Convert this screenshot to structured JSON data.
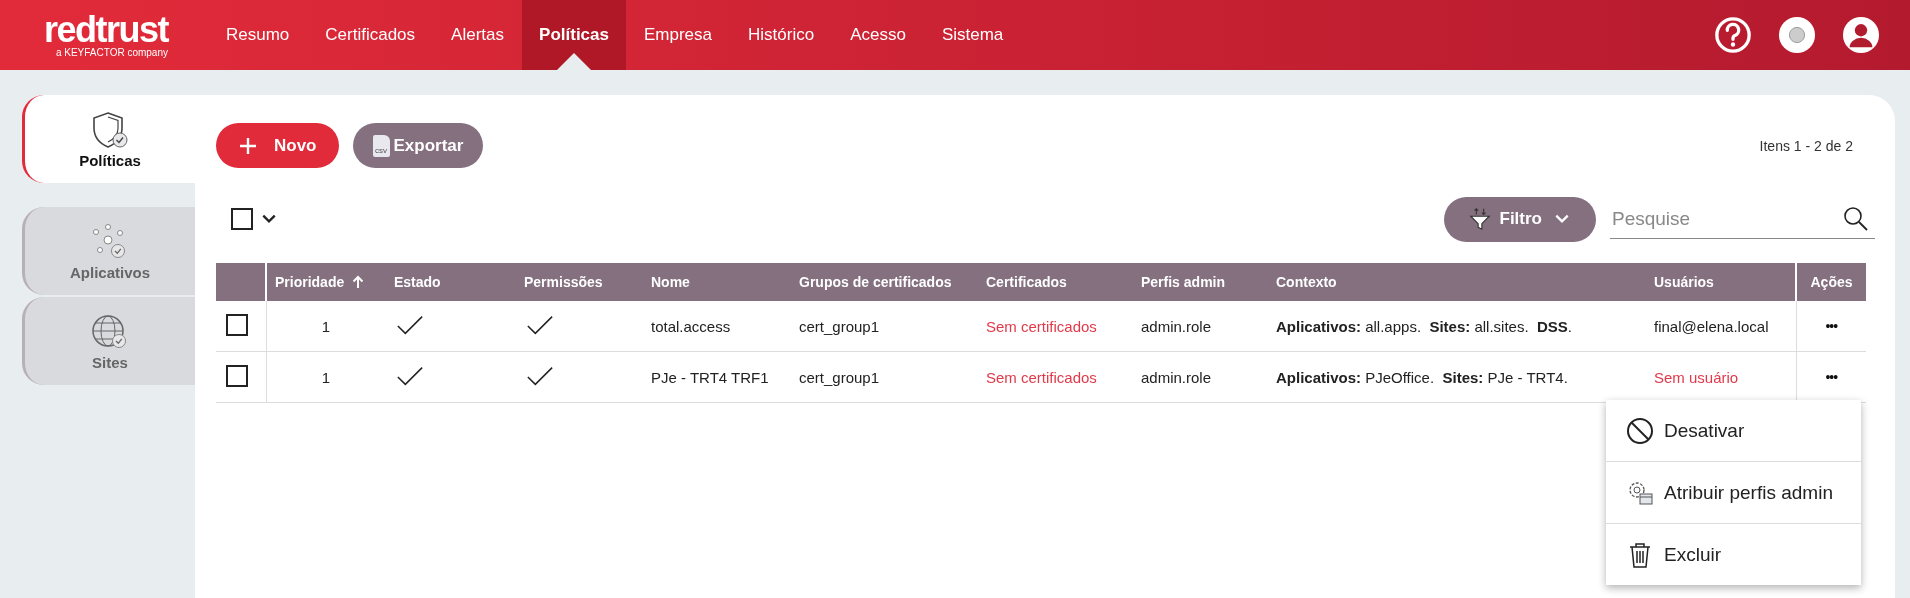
{
  "brand": {
    "name": "redtrust",
    "tagline": "a KEYFACTOR company"
  },
  "nav": [
    {
      "label": "Resumo",
      "selected": false
    },
    {
      "label": "Certificados",
      "selected": false
    },
    {
      "label": "Alertas",
      "selected": false
    },
    {
      "label": "Políticas",
      "selected": true
    },
    {
      "label": "Empresa",
      "selected": false
    },
    {
      "label": "Histórico",
      "selected": false
    },
    {
      "label": "Acesso",
      "selected": false
    },
    {
      "label": "Sistema",
      "selected": false
    }
  ],
  "sidebar": [
    {
      "label": "Políticas",
      "kind": "shield",
      "selected": true
    },
    {
      "label": "Aplicativos",
      "kind": "apps",
      "selected": false
    },
    {
      "label": "Sites",
      "kind": "globe",
      "selected": false
    }
  ],
  "toolbar": {
    "new_button": "Novo",
    "export_button": "Exportar",
    "export_icon_label": "csv",
    "count": "Itens 1 - 2 de 2",
    "filter_button": "Filtro",
    "search": {
      "placeholder": "Pesquise"
    },
    "select_all": {
      "checked": false
    }
  },
  "table": {
    "columns": [
      {
        "label": "Prioridade",
        "sorted_ascending": true
      },
      {
        "label": "Estado"
      },
      {
        "label": "Permissões"
      },
      {
        "label": "Nome"
      },
      {
        "label": "Grupos de certificados"
      },
      {
        "label": "Certificados"
      },
      {
        "label": "Perfis admin"
      },
      {
        "label": "Contexto"
      },
      {
        "label": "Usuários"
      },
      {
        "label": "Ações"
      }
    ],
    "rows": [
      {
        "checked": false,
        "priority": "1",
        "enabled": true,
        "permissions": true,
        "name": "total.access",
        "groups": "cert_group1",
        "certificates": {
          "text": "Sem certificados",
          "empty": true
        },
        "admin_profiles": "admin.role",
        "context": "**Aplicativos:** all.apps.  **Sites:** all.sites.  **DSS**.",
        "users": {
          "text": "final@elena.local",
          "empty": false
        },
        "actions": "•••"
      },
      {
        "checked": false,
        "priority": "1",
        "enabled": true,
        "permissions": true,
        "name": "PJe - TRT4 TRF1",
        "groups": "cert_group1",
        "certificates": {
          "text": "Sem certificados",
          "empty": true
        },
        "admin_profiles": "admin.role",
        "context": "**Aplicativos:** PJeOffice.  **Sites:** PJe - TRT4.",
        "users": {
          "text": "Sem usuário",
          "empty": true
        },
        "actions": "•••"
      }
    ]
  },
  "action_menu": [
    {
      "label": "Desativar",
      "kind": "disable"
    },
    {
      "label": "Atribuir perfis admin",
      "kind": "assign"
    },
    {
      "label": "Excluir",
      "kind": "delete"
    }
  ]
}
